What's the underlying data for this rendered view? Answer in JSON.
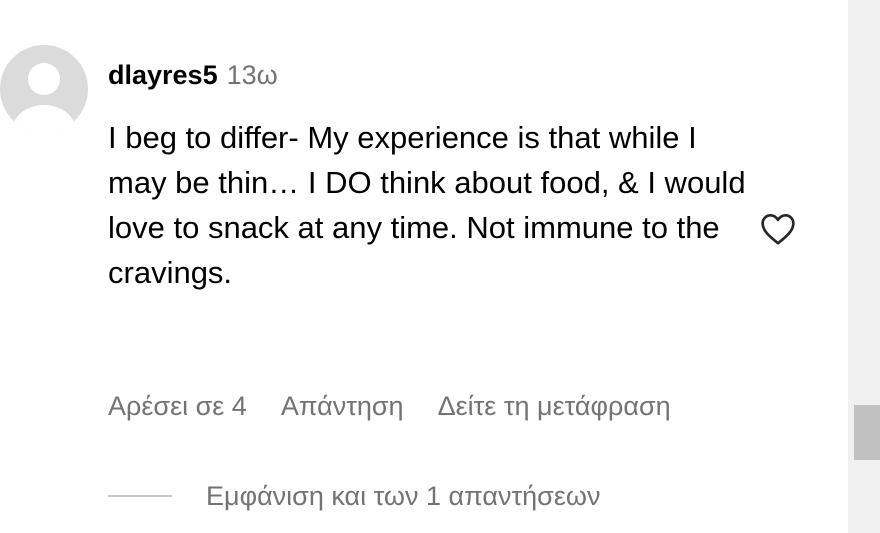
{
  "comment": {
    "username": "dlayres5",
    "timestamp": "13ω",
    "text": "I beg to differ- My experience is that while I may be thin… I DO think about food, & I would love to snack at any time. Not immune to the cravings.",
    "actions": {
      "likes": "Αρέσει σε 4",
      "reply": "Απάντηση",
      "translate": "Δείτε τη μετάφραση"
    },
    "view_replies": "Εμφάνιση και των 1 απαντήσεων"
  },
  "icons": {
    "avatar": "default-user-avatar-icon",
    "like": "heart-outline-icon"
  },
  "colors": {
    "text": "#000000",
    "secondary_text": "#737373",
    "avatar_bg": "#dbdbdb",
    "avatar_fg": "#ffffff",
    "reply_line": "#c7c7c7",
    "scrollbar_track": "#f0f0f0",
    "scrollbar_thumb": "#c1c1c1"
  }
}
